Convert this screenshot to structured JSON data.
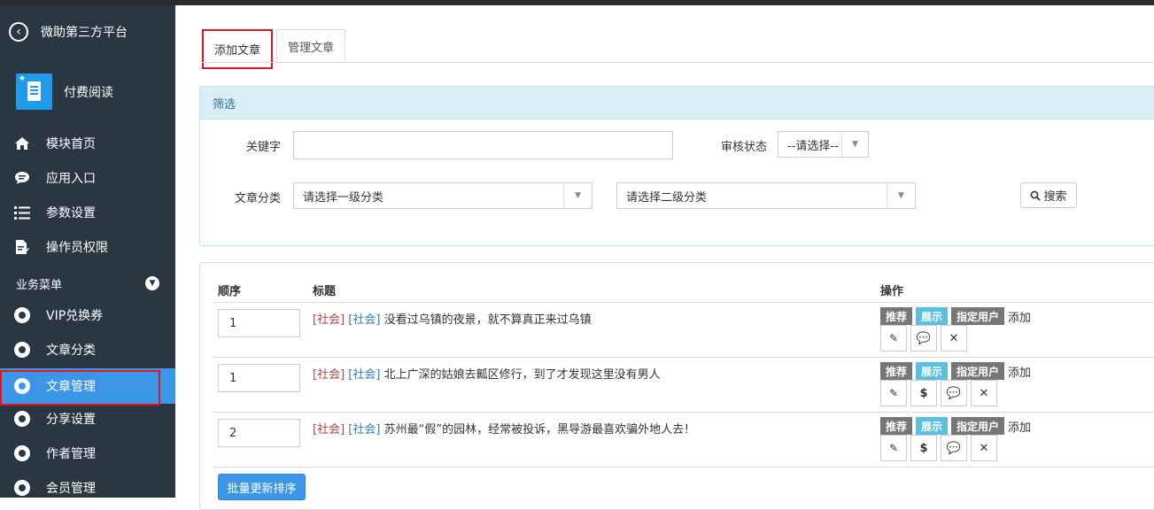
{
  "sidebar": {
    "back_label": "微助第三方平台",
    "module_label": "付费阅读",
    "top_items": [
      {
        "label": "模块首页",
        "icon": "home-icon"
      },
      {
        "label": "应用入口",
        "icon": "chat-icon"
      },
      {
        "label": "参数设置",
        "icon": "list-icon"
      },
      {
        "label": "操作员权限",
        "icon": "doc-edit-icon"
      }
    ],
    "section_label": "业务菜单",
    "business_items": [
      {
        "label": "VIP兑换券"
      },
      {
        "label": "文章分类"
      },
      {
        "label": "文章管理",
        "active": true
      },
      {
        "label": "分享设置"
      },
      {
        "label": "作者管理"
      },
      {
        "label": "会员管理"
      }
    ]
  },
  "tabs": [
    {
      "label": "添加文章"
    },
    {
      "label": "管理文章"
    }
  ],
  "filter": {
    "header": "筛选",
    "keyword_label": "关键字",
    "keyword_value": "",
    "status_label": "审核状态",
    "status_value": "--请选择--",
    "category_label": "文章分类",
    "category1_value": "请选择一级分类",
    "category2_value": "请选择二级分类",
    "search_label": "搜索"
  },
  "table": {
    "col_order": "顺序",
    "col_title": "标题",
    "col_ops": "操作",
    "badge_recommend": "推荐",
    "badge_show": "展示",
    "badge_user": "指定用户",
    "add_label": "添加",
    "rows": [
      {
        "order": "1",
        "cat1": "[社会]",
        "cat2": "[社会]",
        "title": "没看过乌镇的夜景，就不算真正来过乌镇"
      },
      {
        "order": "1",
        "cat1": "[社会]",
        "cat2": "[社会]",
        "title": "北上广深的姑娘去瓤区修行，到了才发现这里没有男人"
      },
      {
        "order": "2",
        "cat1": "[社会]",
        "cat2": "[社会]",
        "title": "苏州最“假”的园林，经常被投诉，黑导游最喜欢骗外地人去！"
      }
    ]
  },
  "batch_label": "批量更新排序"
}
